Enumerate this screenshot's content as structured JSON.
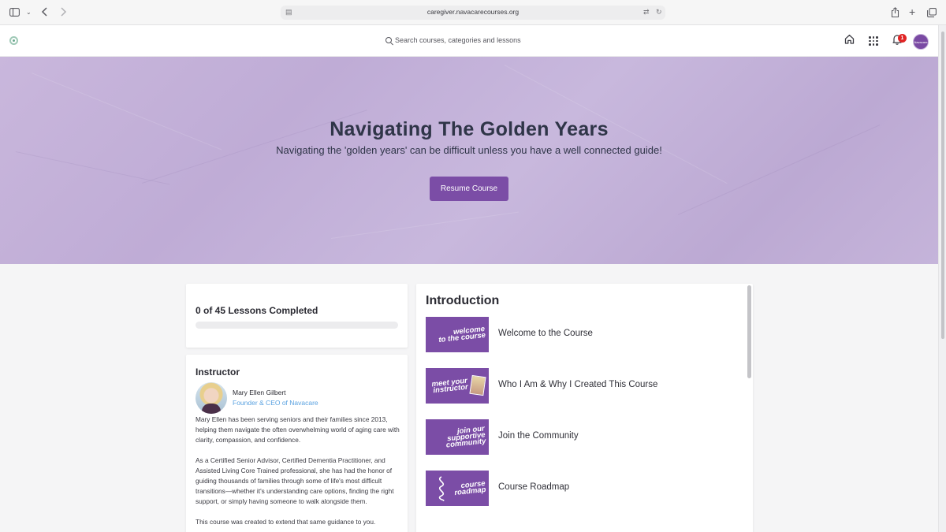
{
  "browser": {
    "url": "caregiver.navacarecourses.org"
  },
  "header": {
    "search_placeholder": "Search courses, categories and lessons",
    "notification_count": "1",
    "avatar_text": "Navacare"
  },
  "hero": {
    "title": "Navigating The Golden Years",
    "subtitle": "Navigating the 'golden years' can be difficult unless you have a well connected guide!",
    "resume_label": "Resume Course"
  },
  "progress": {
    "text": "0 of 45 Lessons Completed",
    "fraction": 0
  },
  "instructor": {
    "heading": "Instructor",
    "name": "Mary Ellen Gilbert",
    "role": "Founder & CEO of Navacare",
    "bio": [
      "Mary Ellen has been serving seniors and their families since 2013, helping them navigate the often overwhelming world of aging care with clarity, compassion, and confidence.",
      "As a Certified Senior Advisor, Certified Dementia Practitioner, and Assisted Living Core Trained professional, she has had the honor of guiding thousands of families through some of life's most difficult transitions—whether it's understanding care options, finding the right support, or simply having someone to walk alongside them.",
      "This course was created to extend that same guidance to you."
    ]
  },
  "section": {
    "title": "Introduction",
    "lessons": [
      {
        "title": "Welcome to the Course",
        "thumb": [
          "welcome",
          "to the course"
        ]
      },
      {
        "title": "Who I Am & Why I Created This Course",
        "thumb": [
          "meet your",
          "instructor"
        ]
      },
      {
        "title": "Join the Community",
        "thumb": [
          "join our",
          "supportive",
          "community"
        ]
      },
      {
        "title": "Course Roadmap",
        "thumb": [
          "course",
          "roadmap"
        ]
      }
    ]
  },
  "colors": {
    "accent": "#7b4da6",
    "hero_bg": "#c5b4da",
    "link": "#5aa2e0",
    "badge": "#e02424"
  }
}
